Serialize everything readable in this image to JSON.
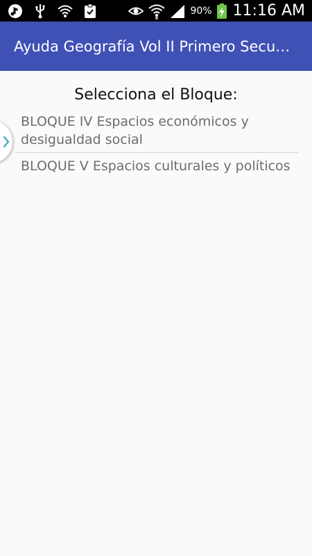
{
  "status_bar": {
    "battery_percent": "90%",
    "time": "11:16 AM",
    "icons": [
      "music-note-icon",
      "usb-icon",
      "wifi-icon",
      "clipboard-check-icon",
      "eye-icon",
      "wifi-signal-icon",
      "cell-signal-icon",
      "battery-charging-icon"
    ]
  },
  "app_bar": {
    "title": "Ayuda Geografía Vol II Primero Secundaria",
    "color": "#3f51b5"
  },
  "main": {
    "heading": "Selecciona el Bloque:",
    "items": [
      {
        "label": "BLOQUE IV Espacios económicos y desigualdad social"
      },
      {
        "label": "BLOQUE V Espacios culturales y políticos"
      }
    ]
  },
  "drawer": {
    "icon": "chevron-right-icon",
    "accent": "#3fa7c6"
  }
}
